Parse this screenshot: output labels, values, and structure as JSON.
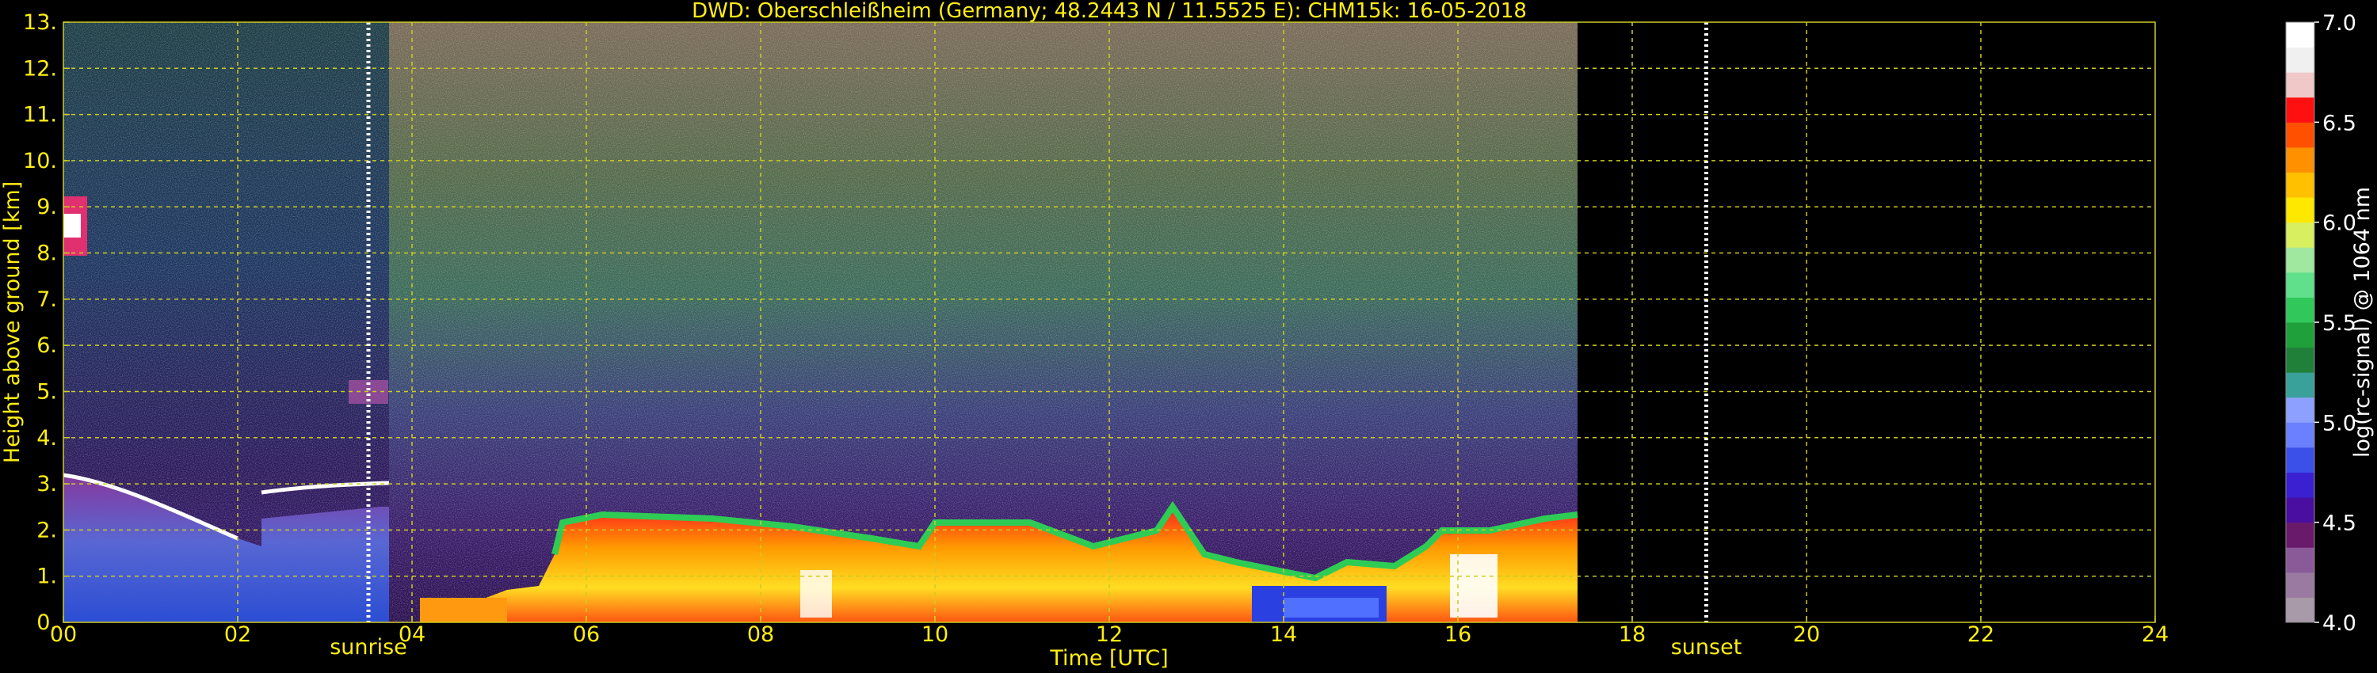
{
  "chart_data": {
    "type": "heatmap",
    "title": "DWD: Oberschleißheim (Germany; 48.2443 N / 11.5525 E):    CHM15k: 16-05-2018",
    "xlabel": "Time [UTC]",
    "ylabel": "Height above ground [km]",
    "xlim": [
      0,
      24
    ],
    "ylim": [
      0,
      13
    ],
    "x_ticks": [
      "00",
      "02",
      "04",
      "06",
      "08",
      "10",
      "12",
      "14",
      "16",
      "18",
      "20",
      "22",
      "24"
    ],
    "y_ticks": [
      "0.",
      "1.",
      "2.",
      "3.",
      "4.",
      "5.",
      "6.",
      "7.",
      "8.",
      "9.",
      "10.",
      "11.",
      "12.",
      "13."
    ],
    "grid": true,
    "data_end_time": 17.4,
    "annotations": [
      {
        "label": "sunrise",
        "time": 3.5
      },
      {
        "label": "sunset",
        "time": 18.85
      }
    ],
    "colorbar": {
      "label": "log(rc-signal) @ 1064 nm",
      "range": [
        4.0,
        7.0
      ],
      "tick_values": [
        4.0,
        4.5,
        5.0,
        5.5,
        6.0,
        6.5,
        7.0
      ],
      "tick_labels": [
        "4.0",
        "4.5",
        "5.0",
        "5.5",
        "6.0",
        "6.5",
        "7.0"
      ]
    },
    "colors": {
      "text": "#ffee11",
      "grid": "#cccc22",
      "background": "#000000",
      "colorbar_white": "#ffffff"
    }
  }
}
